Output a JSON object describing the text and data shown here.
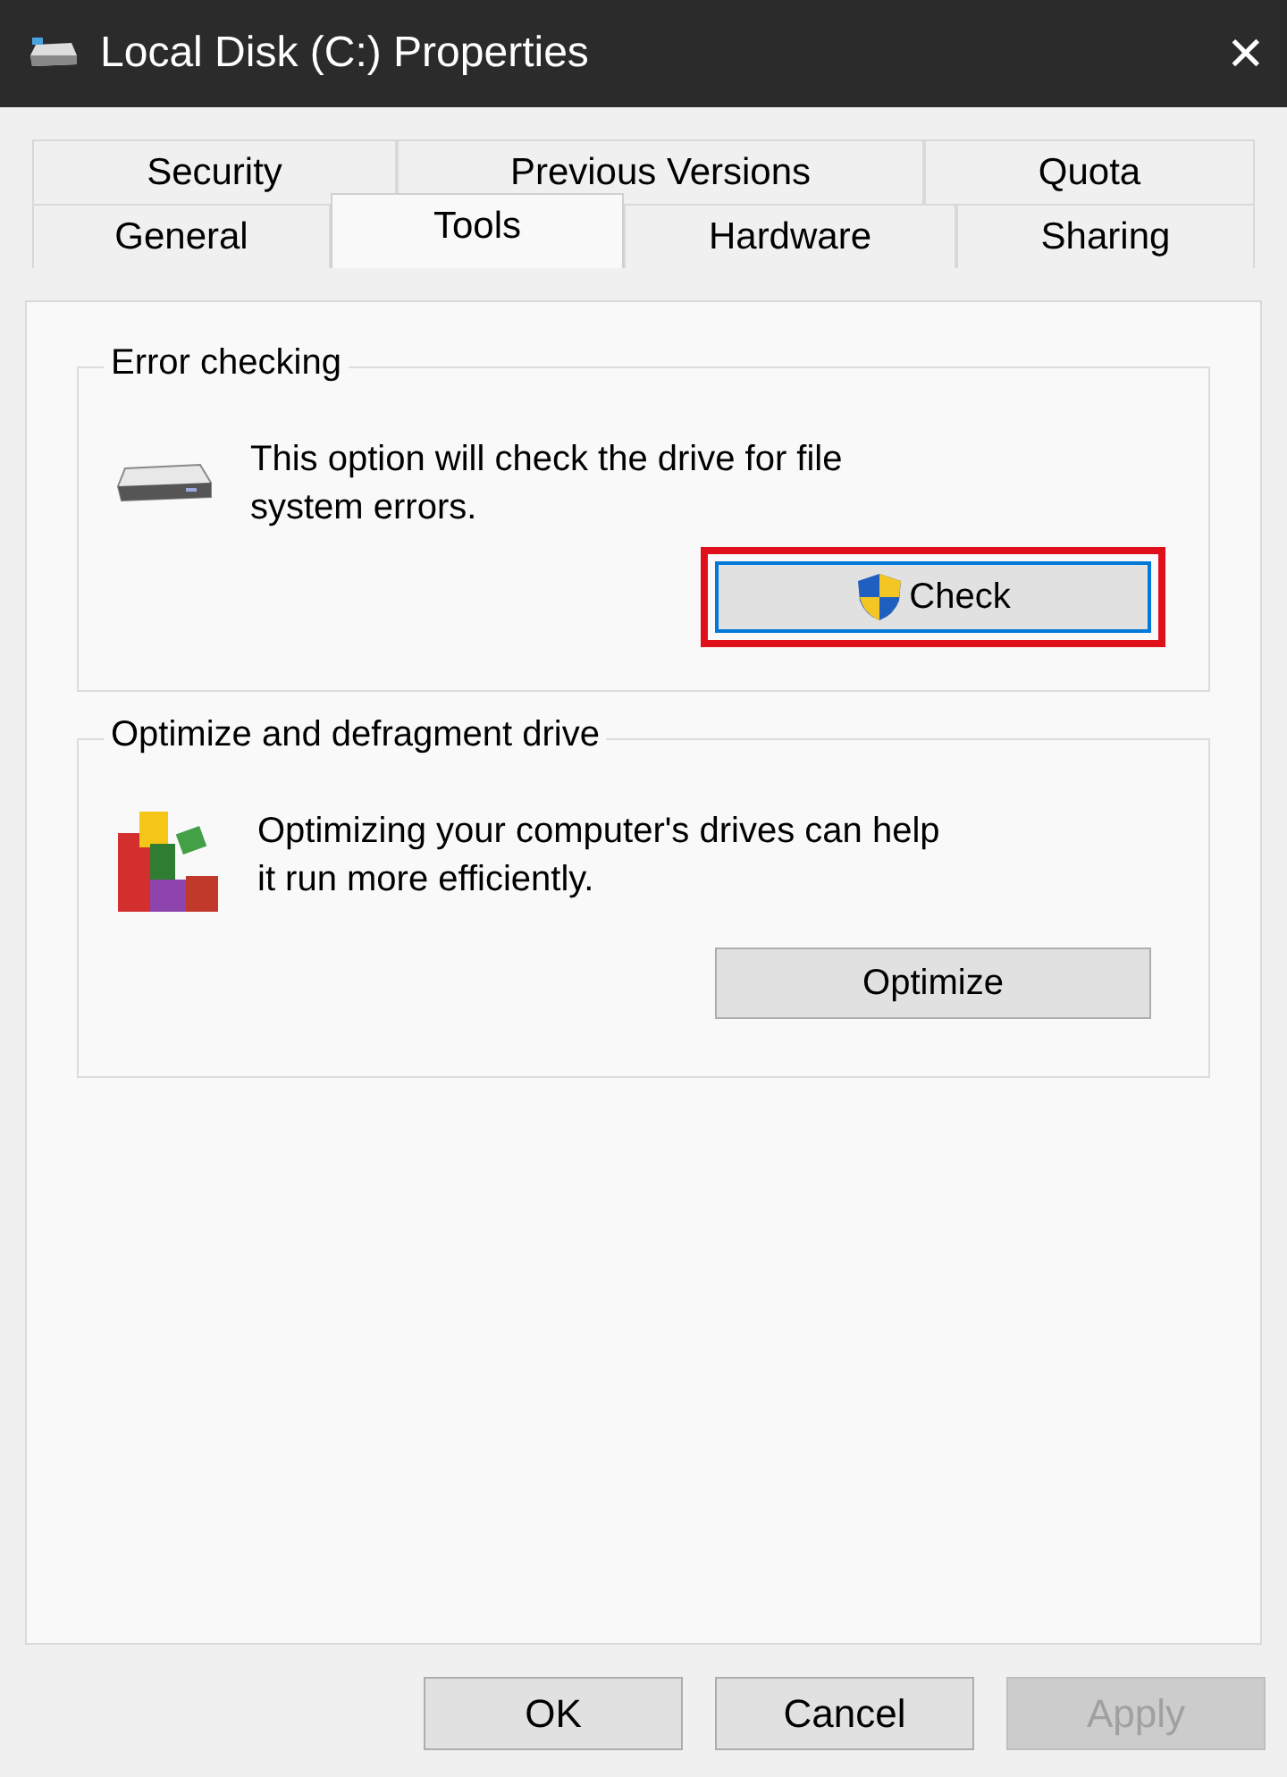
{
  "window": {
    "title": "Local Disk (C:) Properties",
    "close": "✕"
  },
  "tab_rows": [
    {
      "tabs": [
        {
          "label": "Security",
          "selected": false
        },
        {
          "label": "Previous Versions",
          "selected": false
        },
        {
          "label": "Quota",
          "selected": false
        }
      ]
    },
    {
      "tabs": [
        {
          "label": "General",
          "selected": false
        },
        {
          "label": "Tools",
          "selected": true
        },
        {
          "label": "Hardware",
          "selected": false
        },
        {
          "label": "Sharing",
          "selected": false
        }
      ]
    }
  ],
  "groups": [
    {
      "kind": "drive",
      "title": "Error checking",
      "text": "This option will check the drive for file system errors.",
      "button": {
        "label": "Check",
        "shield": true,
        "focused": true,
        "highlighted": true
      }
    },
    {
      "kind": "defrag",
      "title": "Optimize and defragment drive",
      "text": "Optimizing your computer's drives can help it run more efficiently.",
      "button": {
        "label": "Optimize",
        "shield": false,
        "focused": false,
        "highlighted": false
      }
    }
  ],
  "buttons": [
    {
      "label": "OK",
      "disabled": false
    },
    {
      "label": "Cancel",
      "disabled": false
    },
    {
      "label": "Apply",
      "disabled": true
    }
  ]
}
